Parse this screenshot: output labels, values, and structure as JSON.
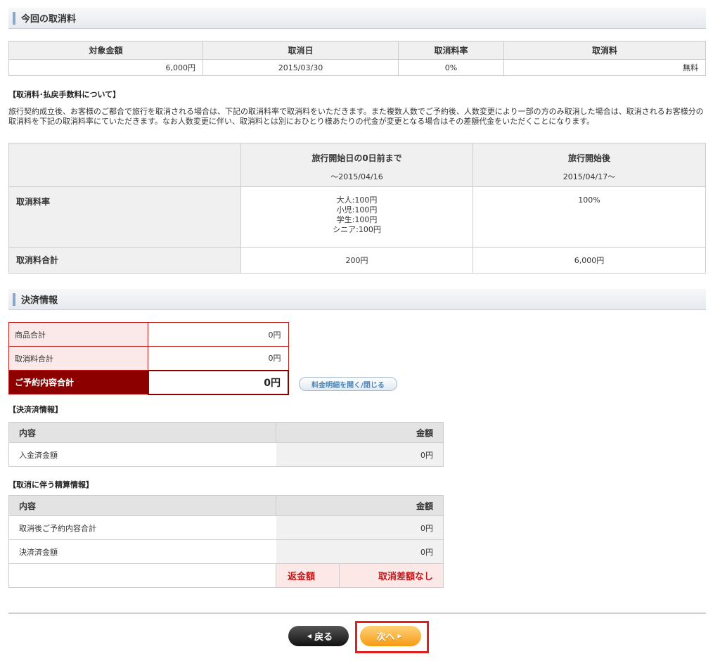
{
  "cancel_section": {
    "title": "今回の取消料",
    "headers": [
      "対象金額",
      "取消日",
      "取消料率",
      "取消料"
    ],
    "row": {
      "amount": "6,000円",
      "date": "2015/03/30",
      "rate": "0%",
      "fee": "無料"
    }
  },
  "policy": {
    "heading": "【取消料･払戻手数料について】",
    "text": "旅行契約成立後、お客様のご都合で旅行を取消される場合は、下記の取消料率で取消料をいただきます。また複数人数でご予約後、人数変更により一部の方のみ取消した場合は、取消されるお客様分の取消料を下記の取消料率にていただきます。なお人数変更に伴い、取消料とは別におひとり様あたりの代金が変更となる場合はその差額代金をいただくことになります。",
    "col1_title": "旅行開始日の0日前まで",
    "col1_sub": "～2015/04/16",
    "col2_title": "旅行開始後",
    "col2_sub": "2015/04/17～",
    "rate_label": "取消料率",
    "rate_col1": [
      "大人:100円",
      "小児:100円",
      "学生:100円",
      "シニア:100円"
    ],
    "rate_col2": "100%",
    "total_label": "取消料合計",
    "total_col1": "200円",
    "total_col2": "6,000円"
  },
  "payment_section": {
    "title": "決済情報",
    "product_total_label": "商品合計",
    "product_total_value": "0円",
    "cancel_total_label": "取消料合計",
    "cancel_total_value": "0円",
    "reservation_total_label": "ご予約内容合計",
    "reservation_total_value": "0円",
    "toggle_label": "料金明細を開く/閉じる"
  },
  "settled_info": {
    "heading": "【決済済情報】",
    "col_content": "内容",
    "col_amount": "金額",
    "rows": [
      {
        "label": "入金済金額",
        "value": "0円"
      }
    ]
  },
  "settlement_info": {
    "heading": "【取消に伴う精算情報】",
    "col_content": "内容",
    "col_amount": "金額",
    "rows": [
      {
        "label": "取消後ご予約内容合計",
        "value": "0円"
      },
      {
        "label": "決済済金額",
        "value": "0円"
      }
    ],
    "refund_label": "返金額",
    "refund_value": "取消差額なし"
  },
  "buttons": {
    "back": "戻る",
    "next": "次へ"
  },
  "colors": {
    "accent_red": "#8c0000",
    "alert_red": "#c01a1a",
    "next_orange": "#f59b12"
  }
}
